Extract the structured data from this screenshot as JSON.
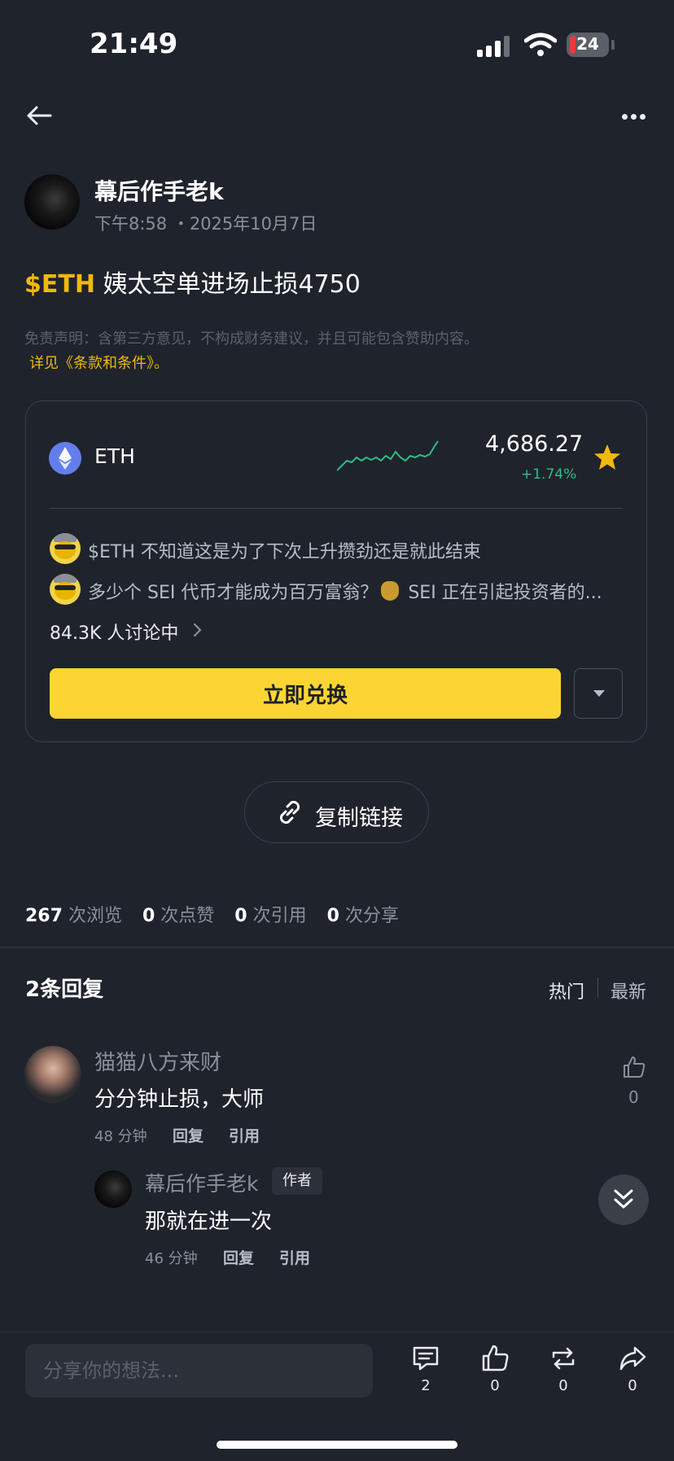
{
  "status_bar": {
    "time": "21:49",
    "battery": "24"
  },
  "post": {
    "author": "幕后作手老k",
    "time": "下午8:58 ・2025年10月7日",
    "tag": "$ETH",
    "title_rest": " 姨太空单进场止损4750",
    "disclaimer": "免责声明：含第三方意见，不构成财务建议，并且可能包含赞助内容。",
    "disclaimer_link": "详见《条款和条件》。"
  },
  "coin_card": {
    "symbol": "ETH",
    "price": "4,686.27",
    "change": "+1.74%",
    "change_color": "#2ebd85",
    "favorite_icon": "star-icon",
    "discussions": [
      {
        "text": "$ETH 不知道这是为了下次上升攒劲还是就此结束"
      },
      {
        "text_a": "多少个 SEI 代币才能成为百万富翁？",
        "text_b": " SEI 正在引起投资者的..."
      }
    ],
    "discuss_count": "84.3K 人讨论中",
    "exchange_label": "立即兑换"
  },
  "copy_link_label": "复制链接",
  "stats": {
    "views_num": "267",
    "views_label": "次浏览",
    "likes_num": "0",
    "likes_label": "次点赞",
    "quotes_num": "0",
    "quotes_label": "次引用",
    "shares_num": "0",
    "shares_label": "次分享"
  },
  "replies": {
    "title": "2条回复",
    "sort_hot": "热门",
    "sort_new": "最新",
    "comments": [
      {
        "name": "猫猫八方来财",
        "text": "分分钟止损，大师",
        "time": "48 分钟",
        "reply": "回复",
        "quote": "引用",
        "likes": "0"
      },
      {
        "name": "幕后作手老k",
        "badge": "作者",
        "text": "那就在进一次",
        "time": "46 分钟",
        "reply": "回复",
        "quote": "引用"
      }
    ]
  },
  "bottom_bar": {
    "placeholder": "分享你的想法...",
    "comments": "2",
    "likes": "0",
    "reposts": "0",
    "shares": "0"
  },
  "colors": {
    "background": "#1f232c",
    "brand_yellow": "#fcd535",
    "accent_yellow": "#f0b90b",
    "up_green": "#2ebd85"
  }
}
